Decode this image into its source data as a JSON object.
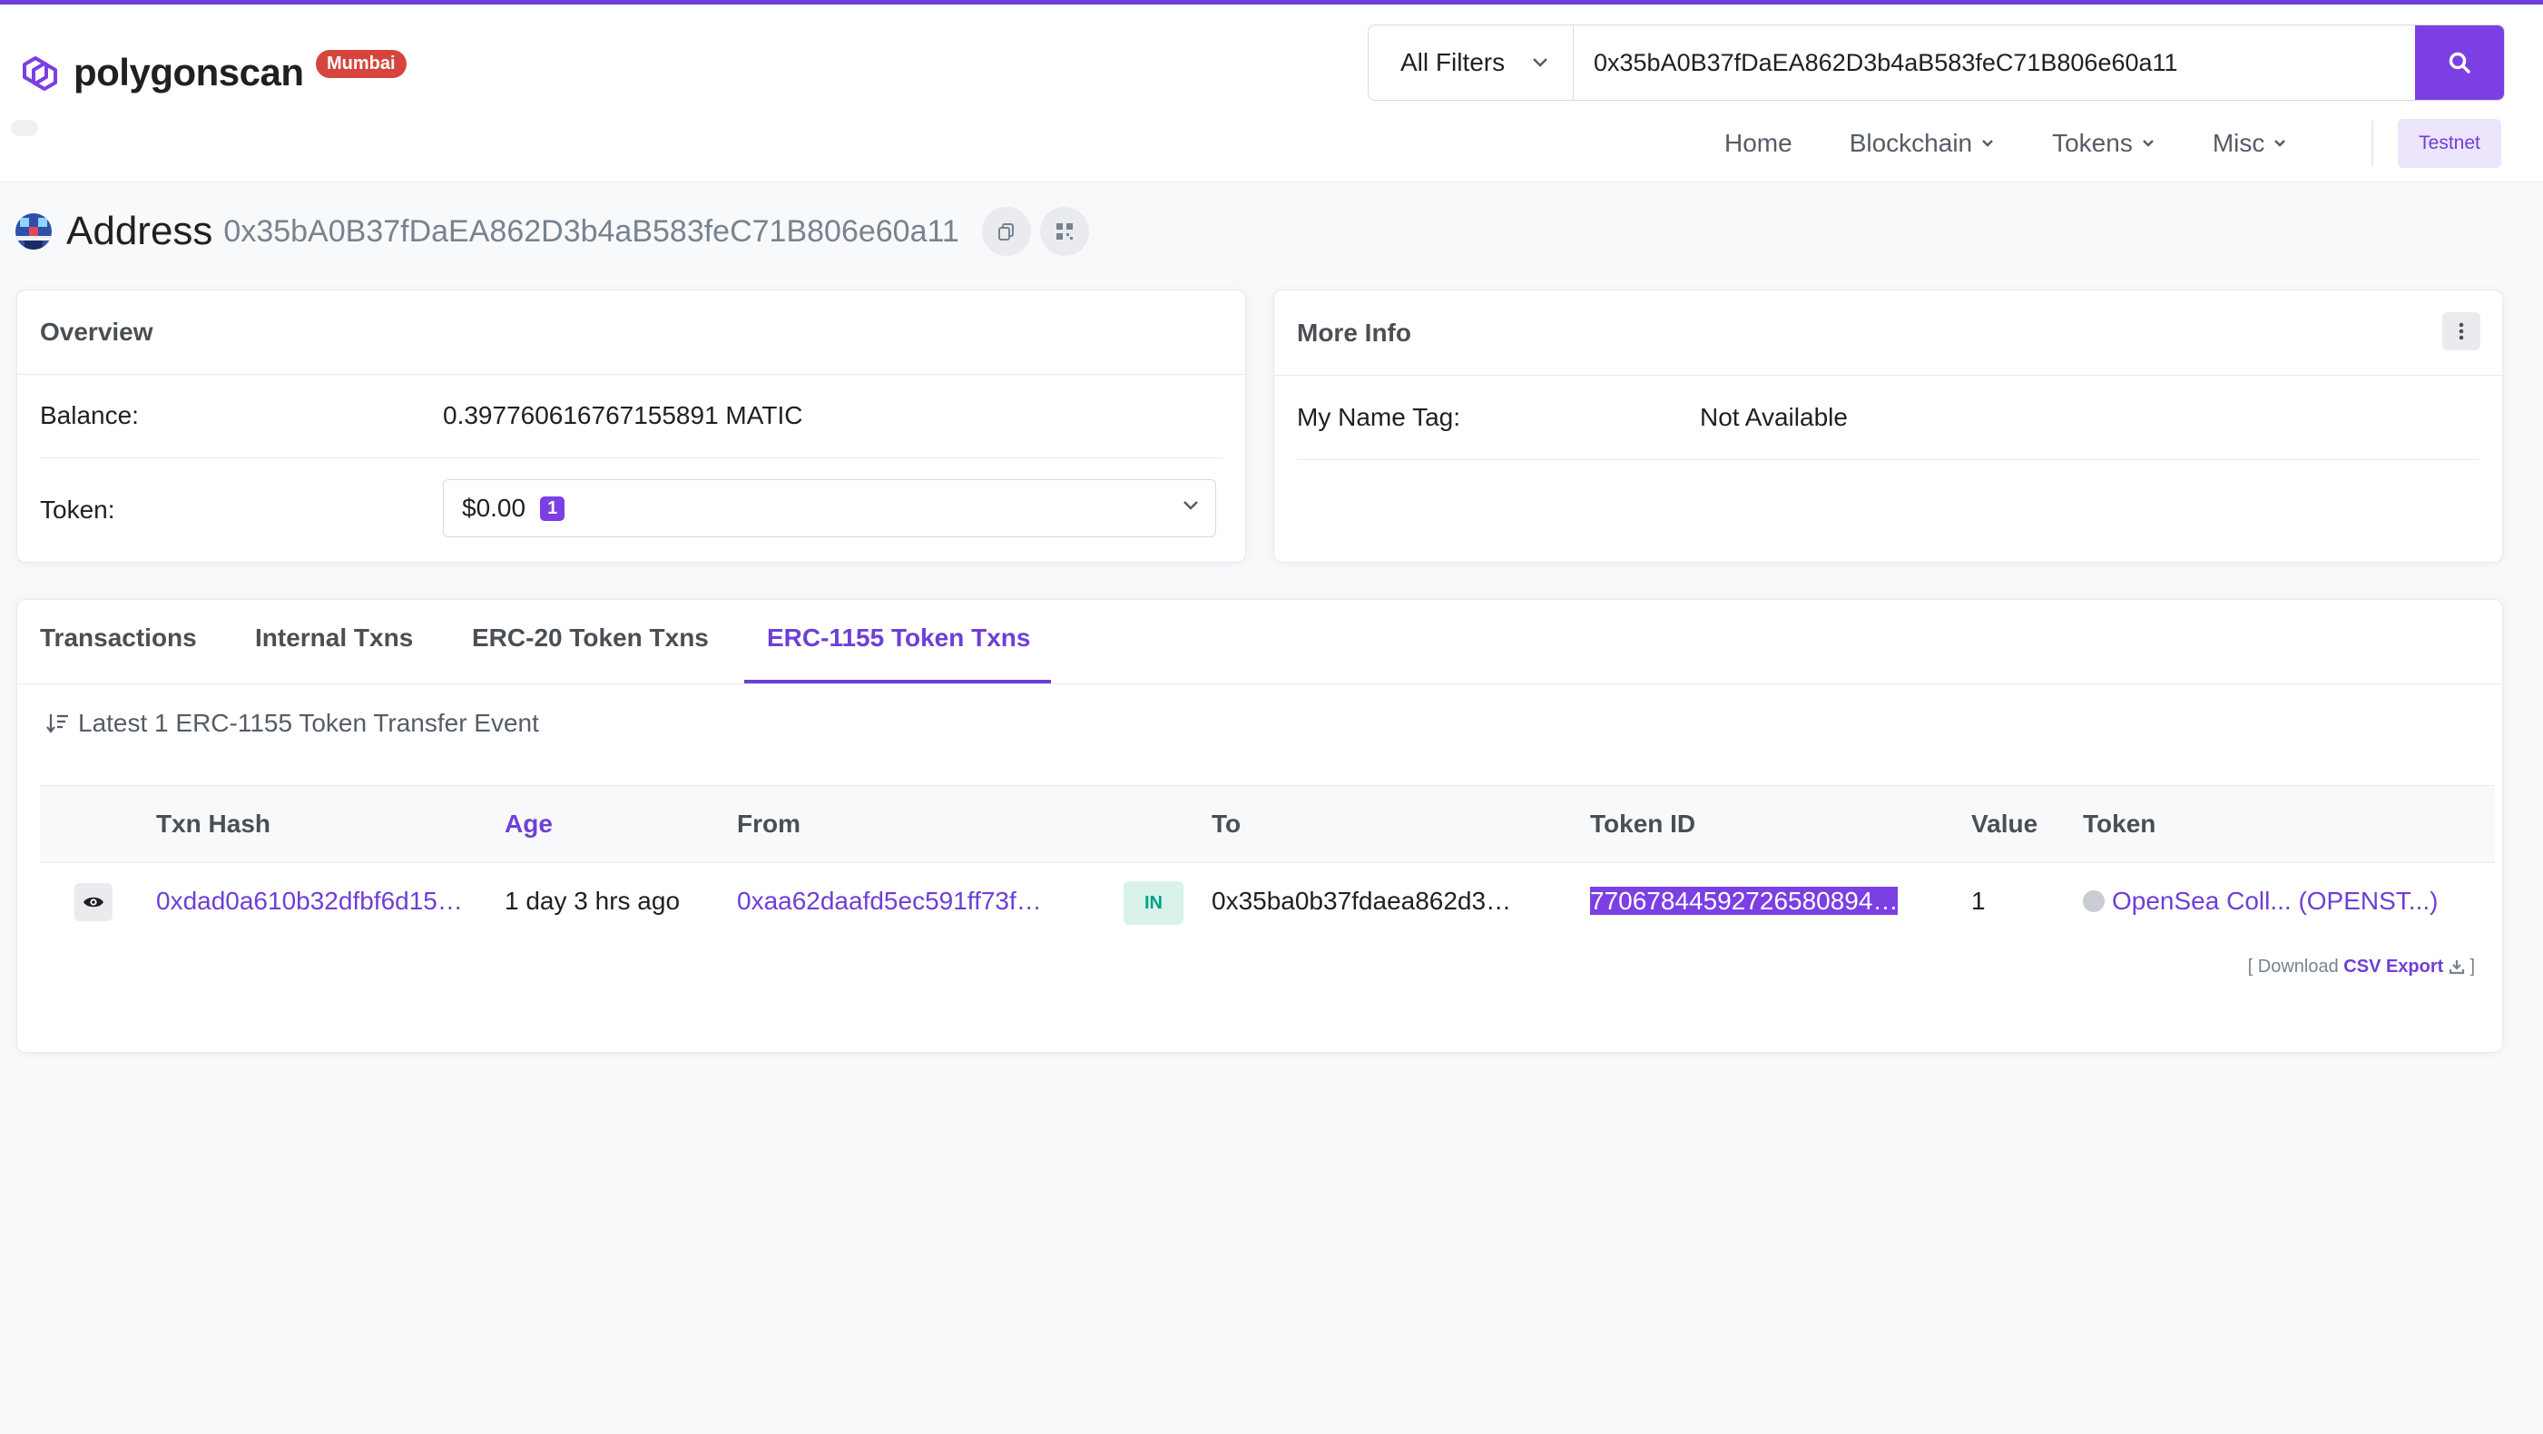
{
  "header": {
    "logo_text": "polygonscan",
    "network_badge": "Mumbai",
    "search": {
      "filter_label": "All Filters",
      "query": "0x35bA0B37fDaEA862D3b4aB583feC71B806e60a11"
    },
    "nav": {
      "home": "Home",
      "blockchain": "Blockchain",
      "tokens": "Tokens",
      "misc": "Misc",
      "testnet": "Testnet"
    }
  },
  "address": {
    "label": "Address",
    "value": "0x35bA0B37fDaEA862D3b4aB583feC71B806e60a11"
  },
  "overview": {
    "title": "Overview",
    "balance_label": "Balance:",
    "balance_value": "0.397760616767155891 MATIC",
    "token_label": "Token:",
    "token_value": "$0.00",
    "token_count": "1"
  },
  "more_info": {
    "title": "More Info",
    "name_tag_label": "My Name Tag:",
    "name_tag_value": "Not Available"
  },
  "tabs": [
    {
      "label": "Transactions"
    },
    {
      "label": "Internal Txns"
    },
    {
      "label": "ERC-20 Token Txns"
    },
    {
      "label": "ERC-1155 Token Txns"
    }
  ],
  "active_tab": "ERC-1155 Token Txns",
  "summary": "Latest 1 ERC-1155 Token Transfer Event",
  "table": {
    "columns": {
      "txn_hash": "Txn Hash",
      "age": "Age",
      "from": "From",
      "to": "To",
      "token_id": "Token ID",
      "value": "Value",
      "token": "Token"
    },
    "rows": [
      {
        "txn_hash": "0xdad0a610b32dfbf6d15…",
        "age": "1 day 3 hrs ago",
        "from": "0xaa62daafd5ec591ff73f…",
        "direction": "IN",
        "to": "0x35ba0b37fdaea862d3…",
        "token_id": "77067844592726580894…",
        "value": "1",
        "token": "OpenSea Coll... (OPENST...)"
      }
    ]
  },
  "csv": {
    "prefix": "[ Download",
    "link": "CSV Export",
    "suffix": "]"
  },
  "colors": {
    "brand": "#7b3fe4",
    "badge_red": "#d6453d",
    "in_badge_bg": "#d9f2ea",
    "in_badge_text": "#00a186"
  }
}
